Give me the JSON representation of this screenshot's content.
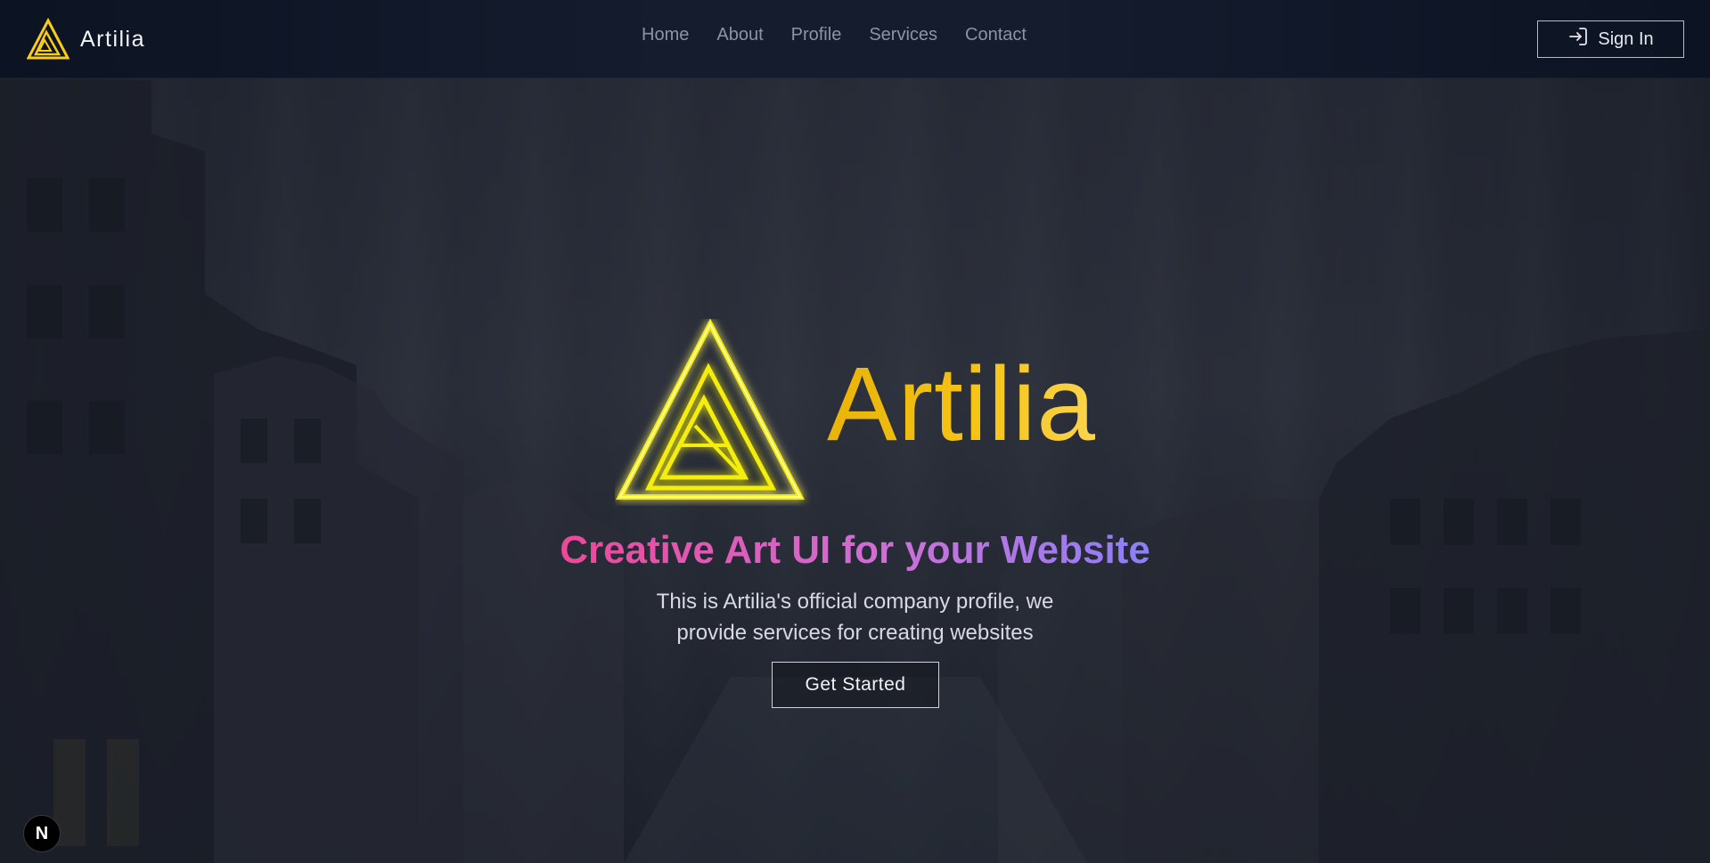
{
  "navbar": {
    "brand_name": "Artilia",
    "links": [
      {
        "label": "Home"
      },
      {
        "label": "About"
      },
      {
        "label": "Profile"
      },
      {
        "label": "Services"
      },
      {
        "label": "Contact"
      }
    ],
    "signin_label": "Sign In",
    "signin_icon": "sign-in-icon"
  },
  "hero": {
    "wordmark": "Artilia",
    "headline": "Creative Art UI for your Website",
    "description_line1": "This is Artilia's official company profile, we",
    "description_line2": "provide services for creating websites",
    "cta_label": "Get Started"
  },
  "dev_badge": {
    "label": "N"
  },
  "colors": {
    "brand_yellow": "#facc15",
    "headline_pink": "#ec4899",
    "headline_violet": "#8b80f7",
    "navbar_bg": "#141c2e"
  }
}
